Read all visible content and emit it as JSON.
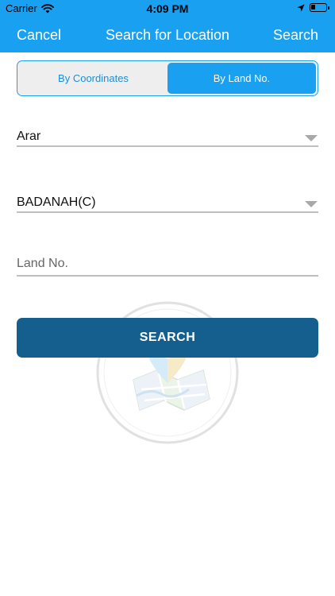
{
  "status_bar": {
    "carrier": "Carrier",
    "time": "4:09 PM",
    "battery_level": 0.3
  },
  "nav": {
    "cancel_label": "Cancel",
    "title": "Search for Location",
    "search_label": "Search"
  },
  "tabs": [
    {
      "label": "By Coordinates",
      "selected": false
    },
    {
      "label": "By Land No.",
      "selected": true
    }
  ],
  "form": {
    "region_value": "Arar",
    "city_value": "BADANAH(C)",
    "land_no_placeholder": "Land No.",
    "land_no_value": "",
    "search_button_label": "SEARCH"
  },
  "colors": {
    "primary": "#1aa0f0",
    "button": "#155f8e",
    "underline": "#bfbfbf"
  }
}
